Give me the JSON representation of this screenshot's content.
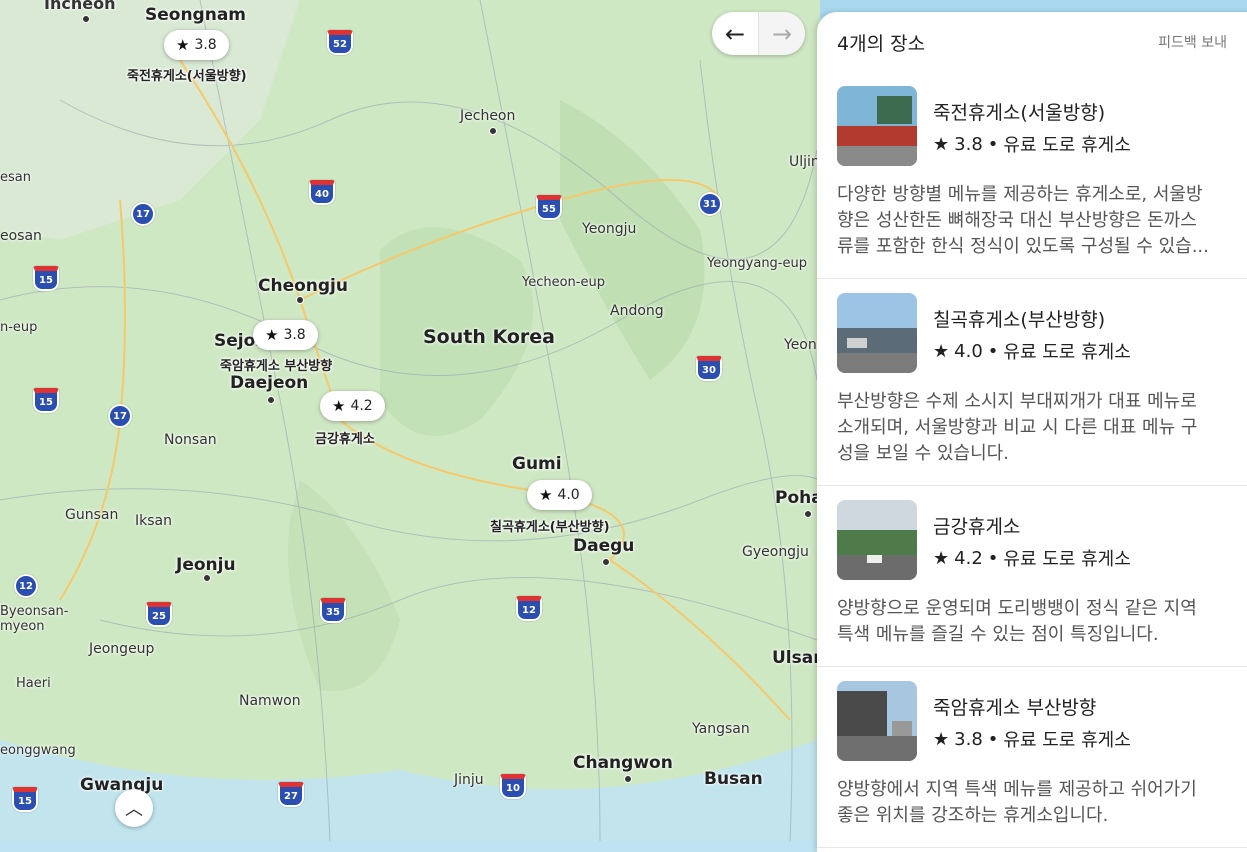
{
  "map": {
    "country_label": "South Korea",
    "cities_big": [
      "Seongnam",
      "Cheongju",
      "Daejeon",
      "Gumi",
      "Daegu",
      "Jeonju",
      "Ulsan",
      "Gwangju",
      "Busan",
      "Changwon",
      "Pohang",
      "Sejong"
    ],
    "cities": [
      "Incheon",
      "Jecheon",
      "Uljin",
      "Yeongju",
      "Yecheon-eup",
      "Andong",
      "Yeongyang-eup",
      "Nonsan",
      "Gunsan",
      "Iksan",
      "Gyeongju",
      "Byeonsan-myeon",
      "Jeongeup",
      "Haeri",
      "Namwon",
      "Yangsan",
      "Jinju",
      "eosan",
      "esan",
      "n-eup",
      "eonggwang",
      "Yeon"
    ],
    "highways": [
      "52",
      "40",
      "17",
      "55",
      "31",
      "15",
      "15",
      "17",
      "30",
      "12",
      "25",
      "35",
      "12",
      "10",
      "27",
      "15"
    ],
    "pins": [
      {
        "rating": "3.8",
        "label": "죽전휴게소(서울방향)"
      },
      {
        "rating": "3.8",
        "label": "죽암휴게소 부산방향"
      },
      {
        "rating": "4.2",
        "label": "금강휴게소"
      },
      {
        "rating": "4.0",
        "label": "칠곡휴게소(부산방향)"
      }
    ],
    "nav": {
      "back_icon": "arrow-left-icon",
      "forward_icon": "arrow-right-icon"
    },
    "expand_icon": "chevron-up-icon"
  },
  "panel": {
    "title": "4개의 장소",
    "feedback": "피드백 보내",
    "places": [
      {
        "name": "죽전휴게소(서울방향)",
        "rating": "3.8",
        "category": "유료 도로 휴게소",
        "desc_lines": [
          "다양한 방향별 메뉴를 제공하는 휴게소로, 서울방",
          "향은 성산한돈 뼈해장국 대신 부산방향은 돈까스",
          "류를 포함한 한식 정식이 있도록 구성될 수 있습..."
        ]
      },
      {
        "name": "칠곡휴게소(부산방향)",
        "rating": "4.0",
        "category": "유료 도로 휴게소",
        "desc_lines": [
          "부산방향은 수제 소시지 부대찌개가 대표 메뉴로",
          "소개되며, 서울방향과 비교 시 다른 대표 메뉴 구",
          "성을 보일 수 있습니다."
        ]
      },
      {
        "name": "금강휴게소",
        "rating": "4.2",
        "category": "유료 도로 휴게소",
        "desc_lines": [
          "양방향으로 운영되며 도리뱅뱅이 정식 같은 지역",
          "특색 메뉴를 즐길 수 있는 점이 특징입니다."
        ]
      },
      {
        "name": "죽암휴게소 부산방향",
        "rating": "3.8",
        "category": "유료 도로 휴게소",
        "desc_lines": [
          "양방향에서 지역 특색 메뉴를 제공하고 쉬어가기",
          "좋은 위치를 강조하는 휴게소입니다."
        ]
      }
    ]
  }
}
